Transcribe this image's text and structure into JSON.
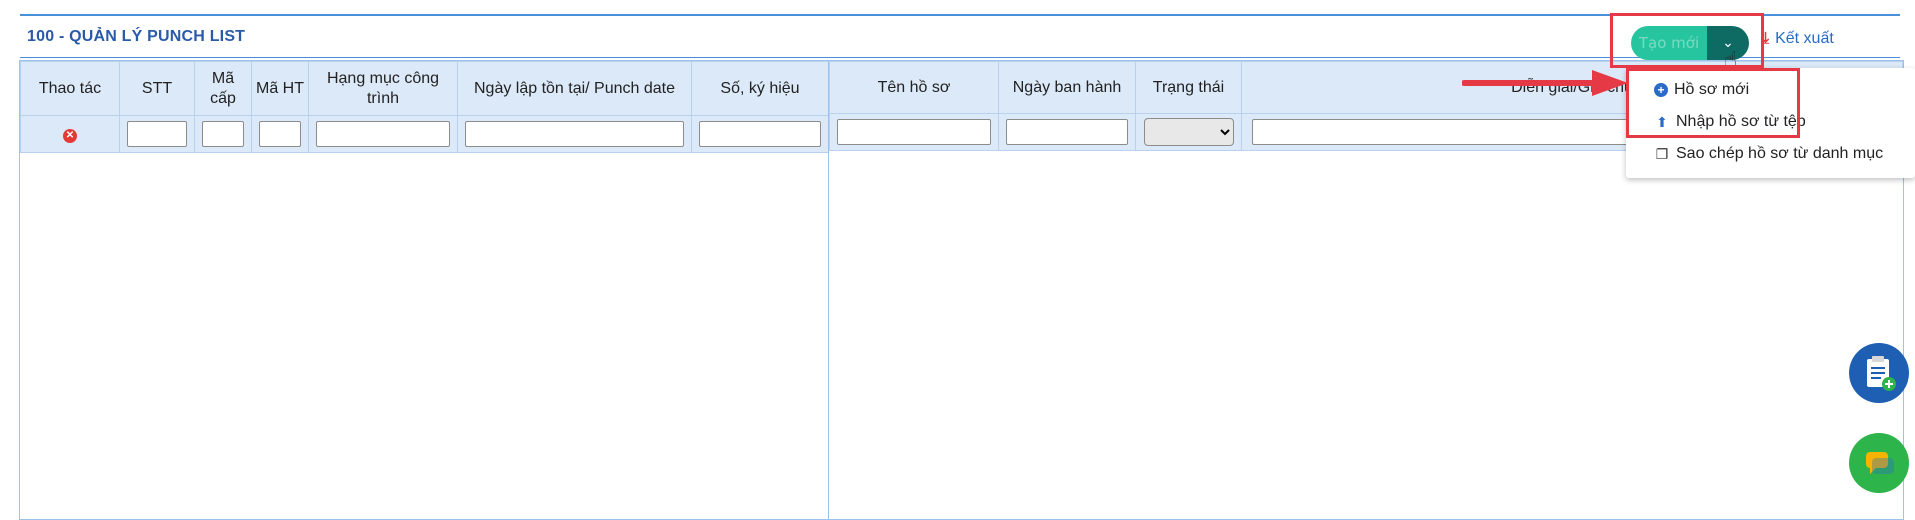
{
  "page": {
    "title": "100 - QUẢN LÝ PUNCH LIST",
    "create_button_label": "Tạo mới",
    "export_label": "Kết xuất"
  },
  "left_table": {
    "columns": [
      "Thao tác",
      "STT",
      "Mã cấp",
      "Mã HT",
      "Hạng mục công trình",
      "Ngày lập tồn tại/ Punch date",
      "Số, ký hiệu"
    ]
  },
  "right_table": {
    "columns": [
      "Tên hồ sơ",
      "Ngày ban hành",
      "Trạng thái",
      "Diễn giải/Ghi chú"
    ]
  },
  "dropdown": {
    "items": [
      {
        "label": "Hồ sơ mới",
        "icon": "plus-circle-icon"
      },
      {
        "label": "Nhập hồ sơ từ tệp",
        "icon": "upload-icon"
      },
      {
        "label": "Sao chép hồ sơ từ danh mục",
        "icon": "copy-icon"
      }
    ]
  },
  "colors": {
    "accent_blue": "#2a5ba8",
    "header_bg": "#dce9f8",
    "button_green": "#26c5a0",
    "button_dark": "#0e6b64",
    "highlight_red": "#e63946"
  }
}
